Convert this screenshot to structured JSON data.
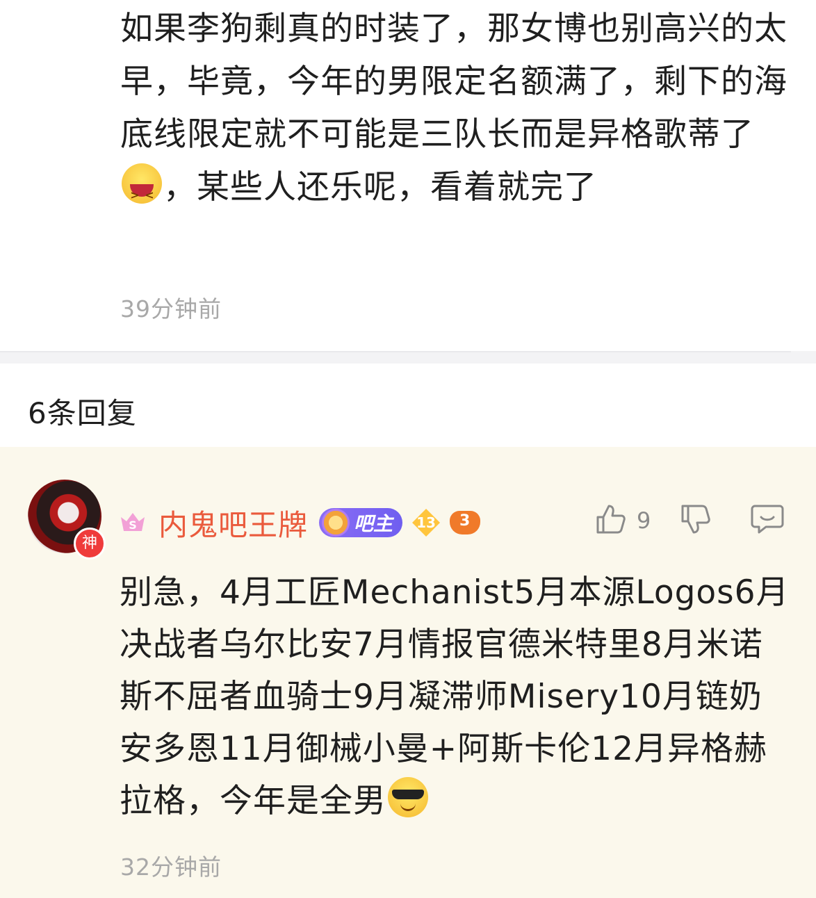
{
  "post": {
    "text_before_emoji": "如果李狗剩真的时装了，那女博也别高兴的太早，毕竟，今年的男限定名额满了，剩下的海底线限定就不可能是三队长而是异格歌蒂了",
    "emoji": "laughing-emoji",
    "text_after_emoji": "，某些人还乐呢，看着就完了",
    "time": "39分钟前"
  },
  "replies_section": {
    "count_label": "6条回复"
  },
  "reply": {
    "avatar_badge": "神",
    "vip_icon": "vip-s-icon",
    "username": "内鬼吧王牌",
    "bazhu_label": "吧主",
    "level": "13",
    "game_badge": "3",
    "like_count": "9",
    "text": "别急，4月工匠Mechanist5月本源Logos6月决战者乌尔比安7月情报官德米特里8月米诺斯不屈者血骑士9月凝滞师Misery10月链奶安多恩11月御械小曼+阿斯卡伦12月异格赫拉格，今年是全男",
    "emoji": "sunglasses-emoji",
    "time": "32分钟前"
  },
  "colors": {
    "username": "#ea5a3c",
    "bazhu_badge": "#7a64f2",
    "reply_bg": "#fbf8ec",
    "timestamp": "#a8a8a8"
  }
}
